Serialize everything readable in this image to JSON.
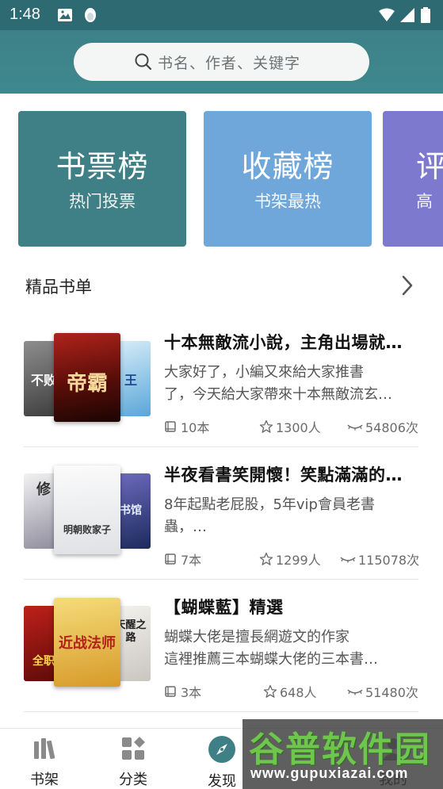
{
  "status_bar": {
    "time": "1:48"
  },
  "search": {
    "placeholder": "书名、作者、关键字"
  },
  "rank_cards": [
    {
      "title": "书票榜",
      "subtitle": "热门投票",
      "color": "#3e8085"
    },
    {
      "title": "收藏榜",
      "subtitle": "书架最热",
      "color": "#6fa7da"
    },
    {
      "title": "评",
      "subtitle": "高",
      "color": "#7c79cf"
    }
  ],
  "section": {
    "title": "精品书单"
  },
  "booklists": [
    {
      "name": "十本無敵流小說，主角出場就…",
      "desc_line1": "大家好了，小編又來給大家推書",
      "desc_line2": "了，今天給大家帶來十本無敵流玄…",
      "count": "10本",
      "followers": "1300人",
      "views": "54806次",
      "cover_text": {
        "left": "不败",
        "middle": "帝霸",
        "right": "王"
      }
    },
    {
      "name": "半夜看書笑開懷！笑點滿滿的…",
      "desc_line1": "8年起點老屁股，5年vip會員老書",
      "desc_line2": "蟲，…",
      "count": "7本",
      "followers": "1299人",
      "views": "115078次",
      "cover_text": {
        "left": "修",
        "middle": "明朝败家子",
        "right": "书馆"
      }
    },
    {
      "name": "【蝴蝶藍】精選",
      "desc_line1": "蝴蝶大佬是擅長網遊文的作家",
      "desc_line2": "這裡推薦三本蝴蝶大佬的三本書…",
      "count": "3本",
      "followers": "648人",
      "views": "51480次",
      "cover_text": {
        "left": "全职",
        "middle": "近战法师",
        "right": "天醒之路"
      }
    }
  ],
  "tabbar": {
    "items": [
      {
        "label": "书架",
        "icon": "bookshelf-icon"
      },
      {
        "label": "分类",
        "icon": "category-icon"
      },
      {
        "label": "发现",
        "icon": "compass-icon"
      },
      {
        "label": "我的",
        "icon": "profile-icon"
      }
    ]
  },
  "watermark": {
    "title": "谷普软件园",
    "url": "www.gupuxiazai.com"
  },
  "colors": {
    "accent": "#3e8085",
    "header": "#3d8188",
    "text_muted": "#6b6b6b"
  }
}
